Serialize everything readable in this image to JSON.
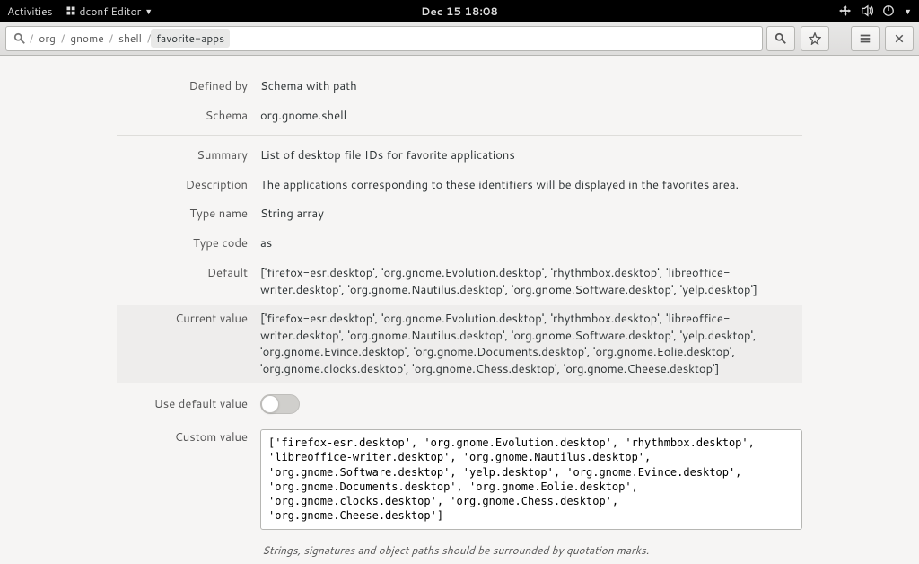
{
  "topbar": {
    "activities": "Activities",
    "app_name": "dconf Editor",
    "clock": "Dec 15  18:08"
  },
  "path": {
    "segments": [
      "org",
      "gnome",
      "shell",
      "favorite-apps"
    ]
  },
  "fields": {
    "defined_by_label": "Defined by",
    "defined_by": "Schema with path",
    "schema_label": "Schema",
    "schema": "org.gnome.shell",
    "summary_label": "Summary",
    "summary": "List of desktop file IDs for favorite applications",
    "description_label": "Description",
    "description": "The applications corresponding to these identifiers will be displayed in the favorites area.",
    "type_name_label": "Type name",
    "type_name": "String array",
    "type_code_label": "Type code",
    "type_code": "as",
    "default_label": "Default",
    "default": "['firefox-esr.desktop', 'org.gnome.Evolution.desktop', 'rhythmbox.desktop', 'libreoffice-writer.desktop', 'org.gnome.Nautilus.desktop', 'org.gnome.Software.desktop', 'yelp.desktop']",
    "current_label": "Current value",
    "current": "['firefox-esr.desktop', 'org.gnome.Evolution.desktop', 'rhythmbox.desktop', 'libreoffice-writer.desktop', 'org.gnome.Nautilus.desktop', 'org.gnome.Software.desktop', 'yelp.desktop', 'org.gnome.Evince.desktop', 'org.gnome.Documents.desktop', 'org.gnome.Eolie.desktop', 'org.gnome.clocks.desktop', 'org.gnome.Chess.desktop', 'org.gnome.Cheese.desktop']",
    "use_default_label": "Use default value",
    "custom_label": "Custom value",
    "custom_value": "['firefox-esr.desktop', 'org.gnome.Evolution.desktop', 'rhythmbox.desktop', 'libreoffice-writer.desktop', 'org.gnome.Nautilus.desktop', 'org.gnome.Software.desktop', 'yelp.desktop', 'org.gnome.Evince.desktop', 'org.gnome.Documents.desktop', 'org.gnome.Eolie.desktop', 'org.gnome.clocks.desktop', 'org.gnome.Chess.desktop', 'org.gnome.Cheese.desktop']",
    "hint": "Strings, signatures and object paths should be surrounded by quotation marks."
  }
}
